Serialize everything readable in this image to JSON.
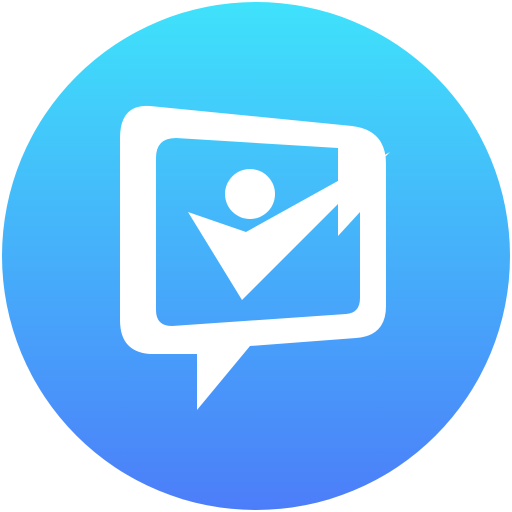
{
  "icon": {
    "name": "chat-checkmark-person-app-icon",
    "colors": {
      "gradient_top": "#3FE2FB",
      "gradient_bottom": "#4C7DF9",
      "glyph": "#FFFFFF",
      "background": "#FFFFFF"
    }
  }
}
